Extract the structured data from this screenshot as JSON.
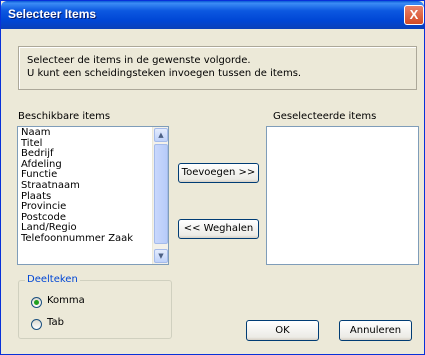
{
  "window": {
    "title": "Selecteer Items",
    "close_glyph": "X"
  },
  "instructions": {
    "line1": "Selecteer de items in de gewenste volgorde.",
    "line2": "U kunt een scheidingsteken invoegen tussen de items."
  },
  "available": {
    "label": "Beschikbare items",
    "items": [
      "Naam",
      "Titel",
      "Bedrijf",
      "Afdeling",
      "Functie",
      "Straatnaam",
      "Plaats",
      "Provincie",
      "Postcode",
      "Land/Regio",
      "Telefoonnummer Zaak"
    ]
  },
  "selected": {
    "label": "Geselecteerde items",
    "items": []
  },
  "buttons": {
    "add": "Toevoegen >>",
    "remove": "<< Weghalen",
    "ok": "OK",
    "cancel": "Annuleren"
  },
  "separator": {
    "legend": "Deelteken",
    "options": [
      "Komma",
      "Tab"
    ],
    "selected": "Komma"
  },
  "icons": {
    "close": "close-icon",
    "scroll_up": "chevron-up-icon",
    "scroll_down": "chevron-down-icon"
  },
  "colors": {
    "titlebar": "#0054e3",
    "dialog_bg": "#ece9d8",
    "legend_text": "#0046d5",
    "radio_dot": "#21a121"
  }
}
